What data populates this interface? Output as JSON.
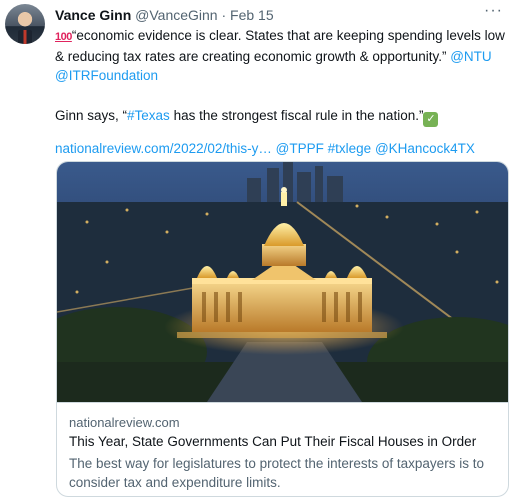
{
  "author": {
    "name": "Vance Ginn",
    "handle": "@VanceGinn",
    "separator": "·",
    "date": "Feb 15"
  },
  "more_label": "···",
  "tweet": {
    "emoji_100": "100",
    "line1": "“economic evidence is clear. States that are keeping spending levels low",
    "line2_text": "& reducing tax rates are creating economic growth & opportunity.” ",
    "mention_ntu": "@NTU",
    "mention_itr": "@ITRFoundation",
    "quote_prefix": "Ginn says, “",
    "hashtag_texas": "#Texas",
    "quote_suffix": " has the strongest fiscal rule in the nation.”",
    "checkmark": "✓",
    "link": "nationalreview.com/2022/02/this-y…",
    "mention_tppf": "@TPPF",
    "hashtag_txlege": "#txlege",
    "mention_khancock": "@KHancock4TX"
  },
  "card": {
    "domain": "nationalreview.com",
    "title": "This Year, State Governments Can Put Their Fiscal Houses in Order",
    "description": "The best way for legislatures to protect the interests of taxpayers is to consider tax and expenditure limits."
  },
  "colors": {
    "link": "#1d9bf0",
    "muted": "#536471",
    "border": "#cfd9de"
  }
}
